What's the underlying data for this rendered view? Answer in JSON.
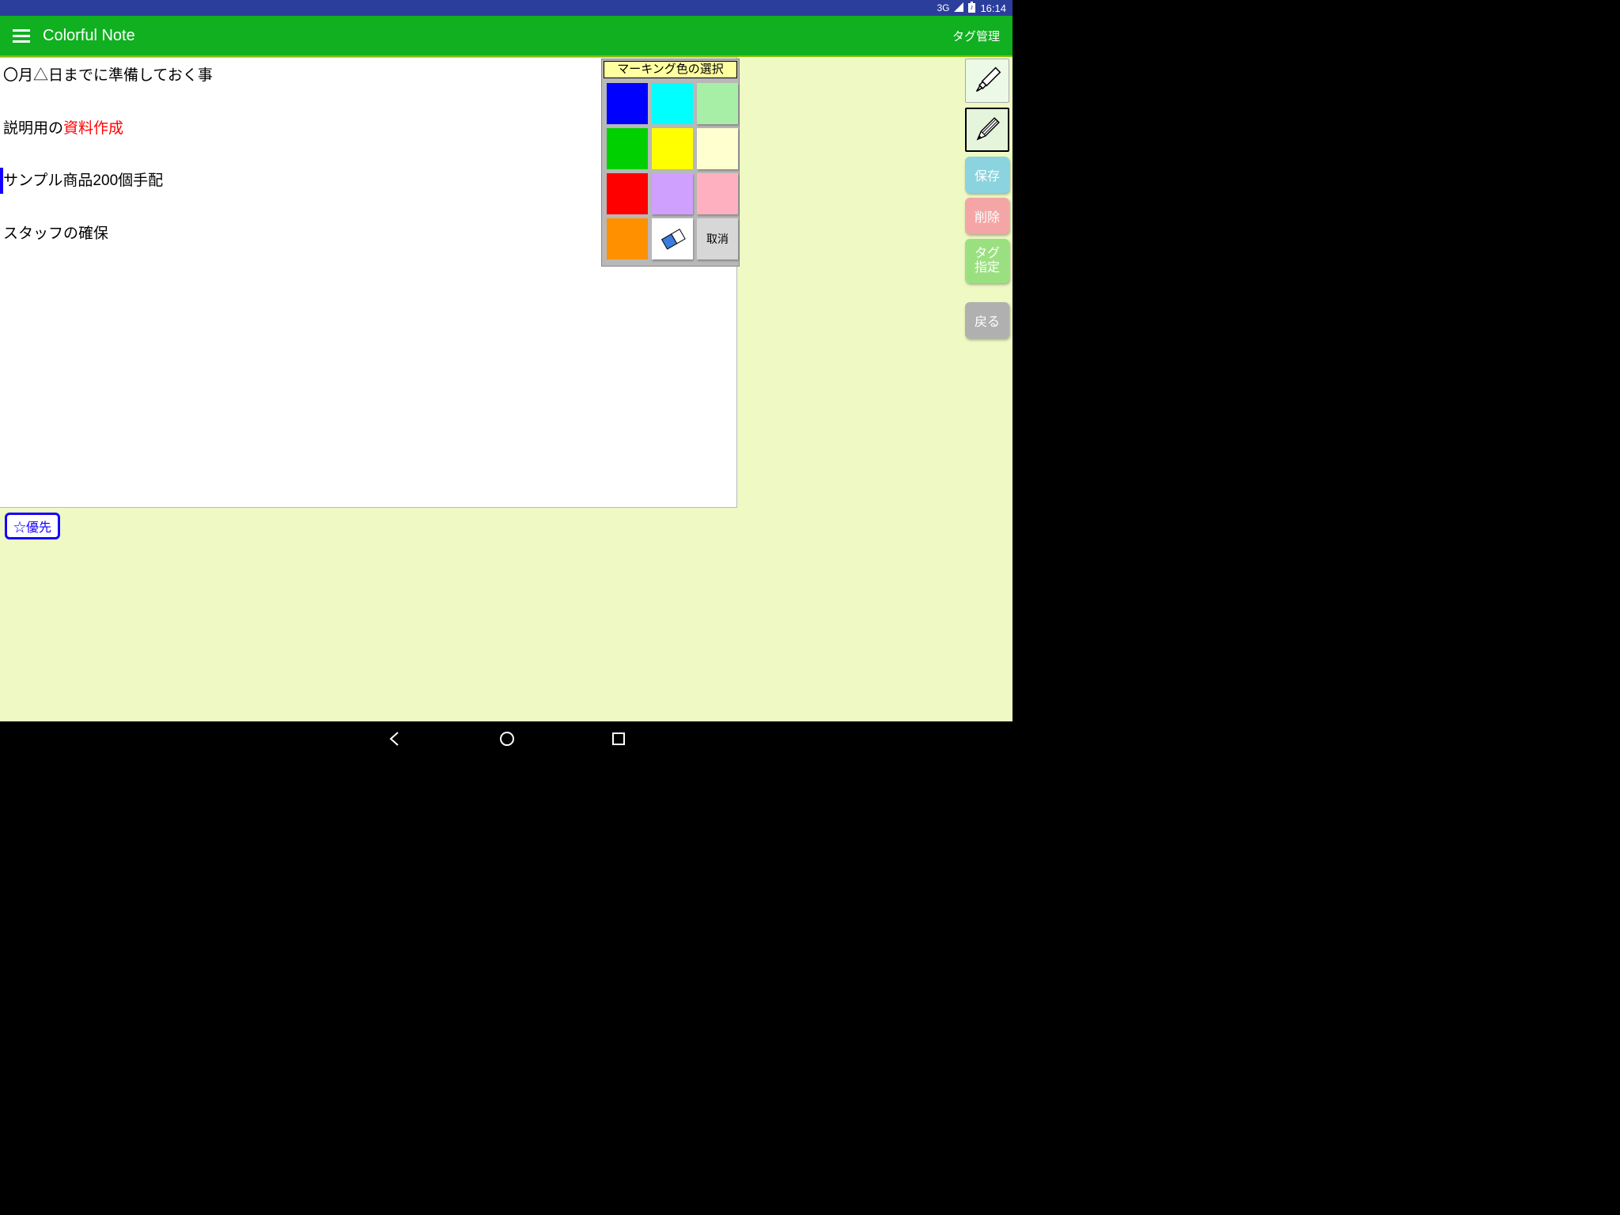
{
  "status": {
    "network": "3G",
    "time": "16:14"
  },
  "appbar": {
    "title": "Colorful Note",
    "right_action": "タグ管理"
  },
  "note": {
    "line1": "〇月△日までに準備しておく事",
    "line2_prefix": "説明用の",
    "line2_highlight": "資料作成",
    "line3": "サンプル商品200個手配",
    "line4": "スタッフの確保"
  },
  "palette": {
    "title": "マーキング色の選択",
    "colors": {
      "blue": "#0000ff",
      "cyan": "#00ffff",
      "lightgreen": "#a7eea7",
      "green": "#00d000",
      "yellow": "#ffff00",
      "lightyellow": "#ffffcf",
      "red": "#ff0000",
      "lavender": "#d0a0ff",
      "pink": "#ffb0c0",
      "orange": "#ff9000"
    },
    "cancel": "取消"
  },
  "side": {
    "save": "保存",
    "delete": "削除",
    "tag_line1": "タグ",
    "tag_line2": "指定",
    "back": "戻る"
  },
  "tag": {
    "priority": "☆優先"
  }
}
